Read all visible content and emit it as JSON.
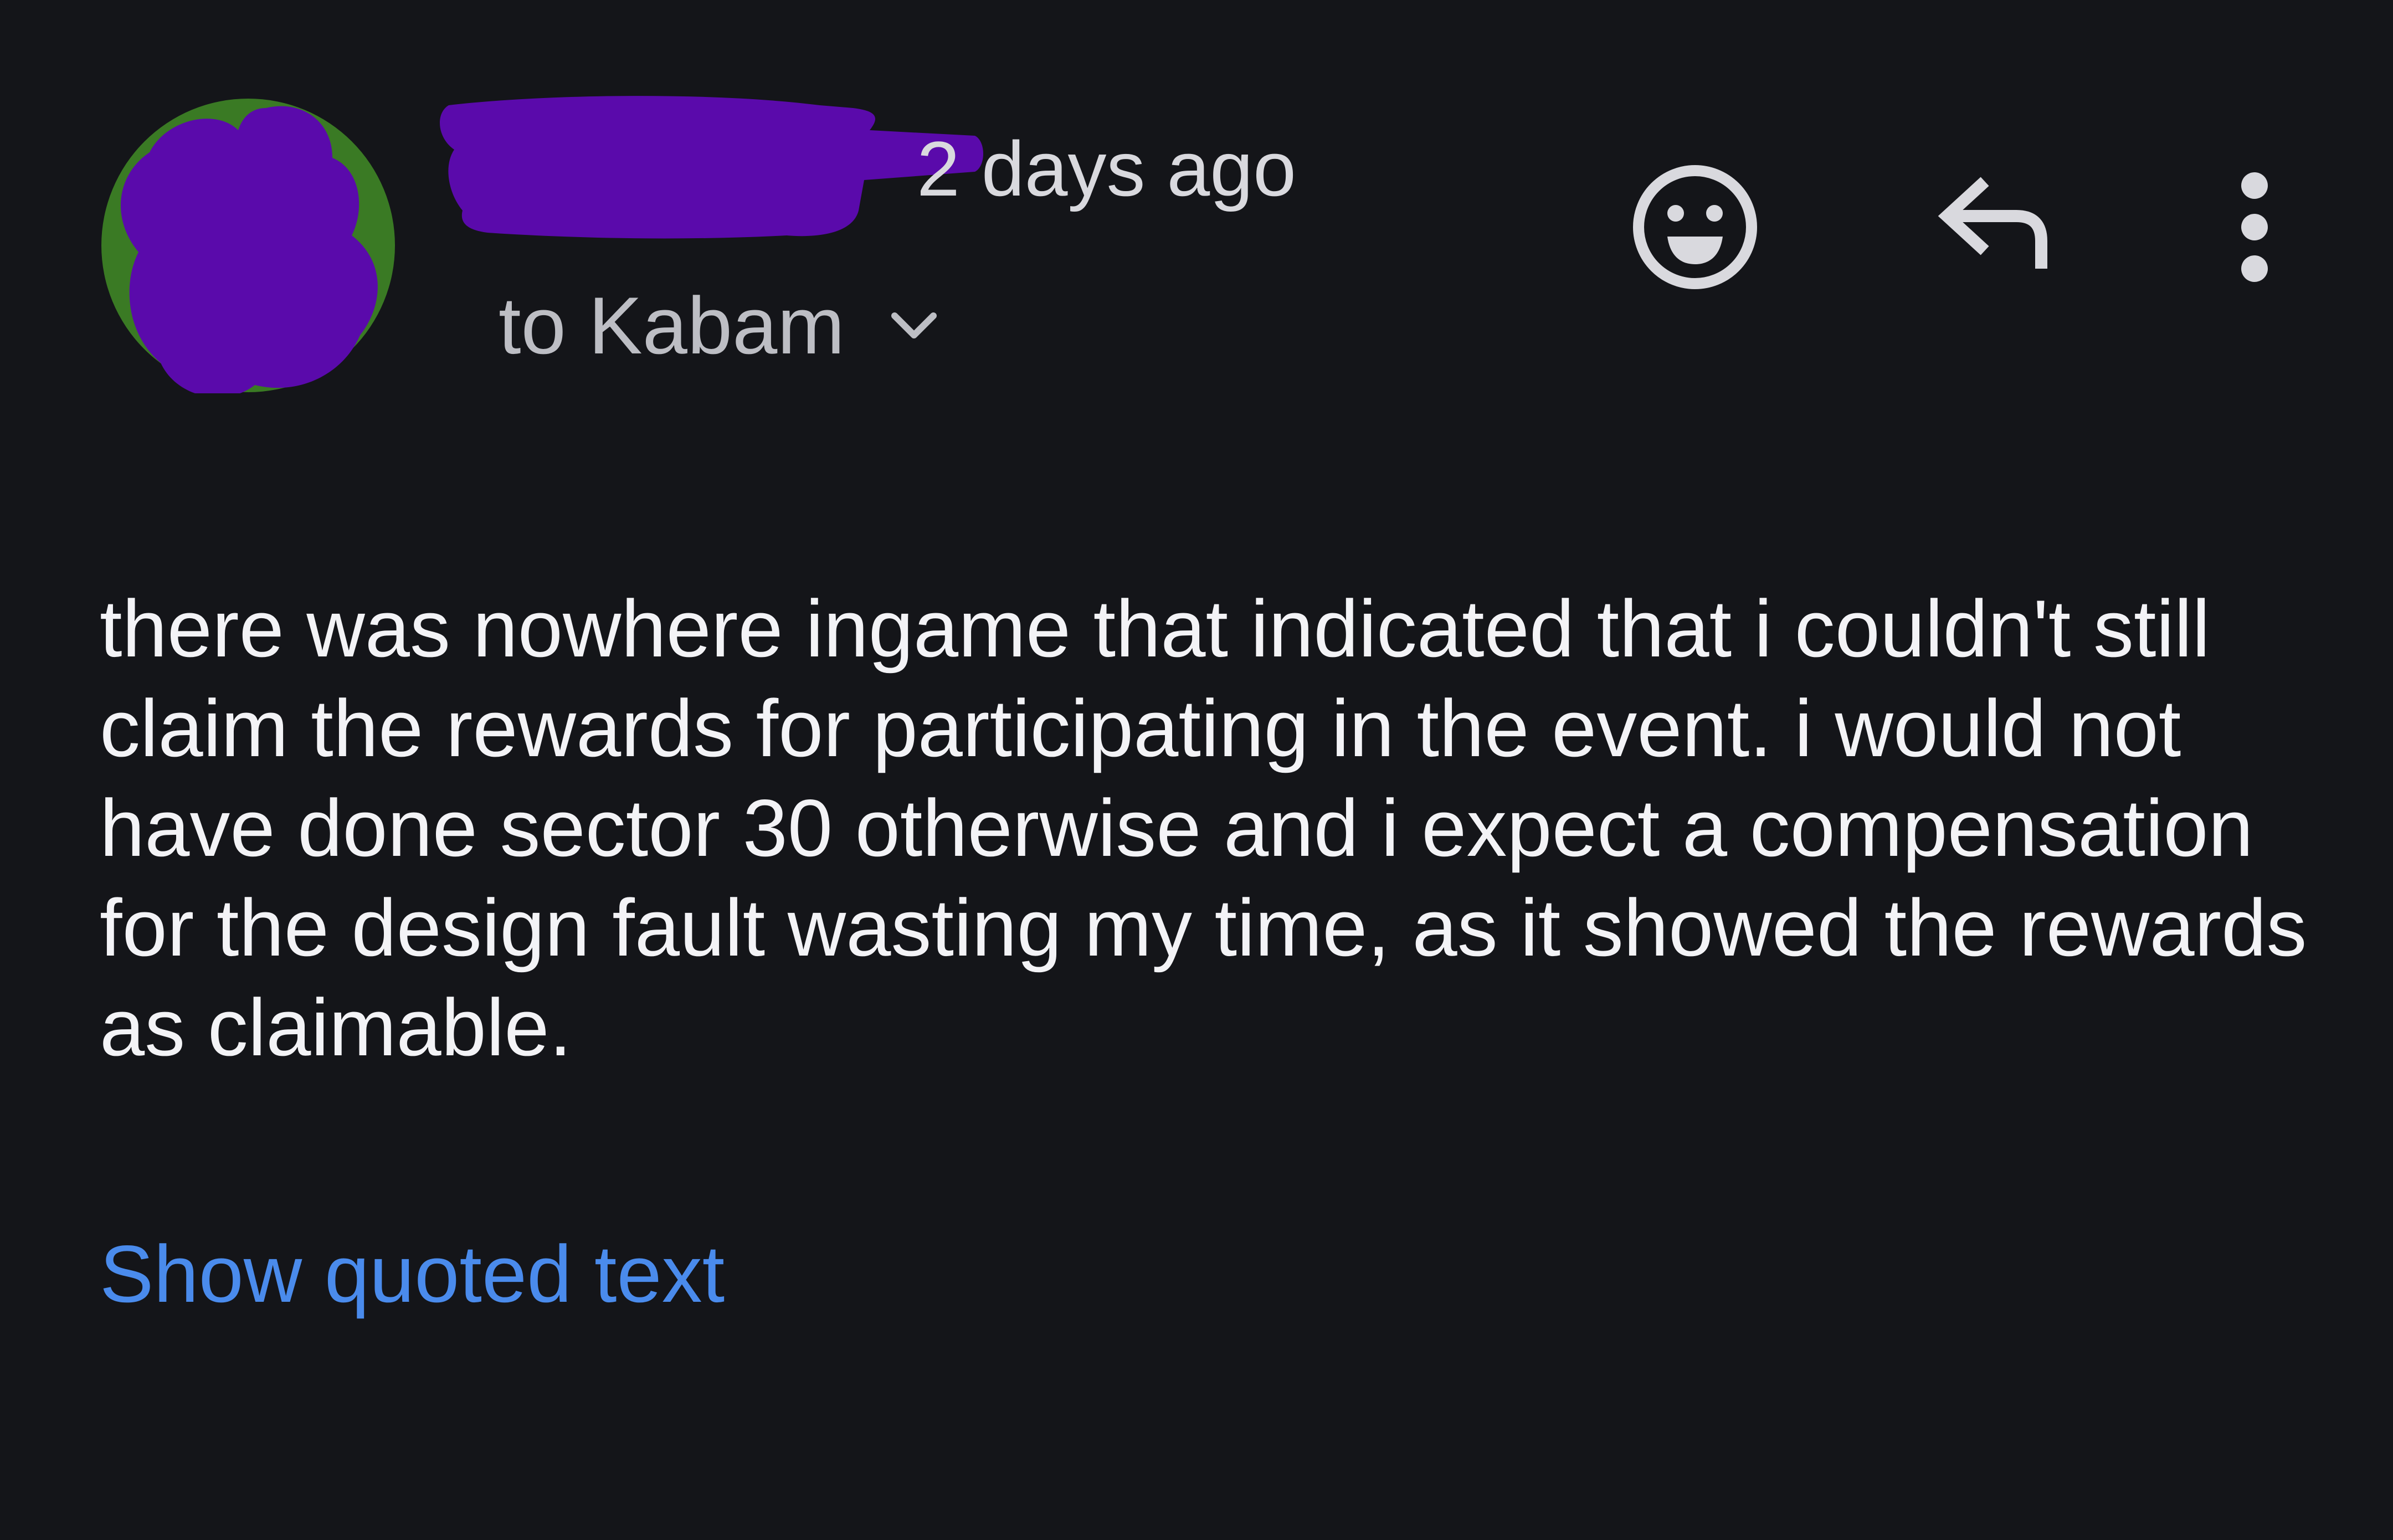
{
  "message": {
    "timestamp": "2 days ago",
    "recipient": "to Kabam",
    "body": "there was nowhere ingame that indicated that i couldn't still claim the rewards for participating in the event. i would not have done sector 30 otherwise and i expect a compensation for the design fault wasting my time, as it showed the rewards as claimable.",
    "show_quoted_label": "Show quoted text"
  },
  "icons": {
    "avatar": "avatar",
    "recipient_expand": "chevron-down-icon",
    "react": "emoji-smile-icon",
    "reply": "reply-arrow-icon",
    "more": "more-vertical-icon"
  },
  "colors": {
    "background": "#141519",
    "body_text": "#f3f3f6",
    "secondary_text": "#bdbec4",
    "link": "#4a8bec",
    "redaction": "#5a0aab",
    "avatar_ring": "#3a7a24"
  }
}
